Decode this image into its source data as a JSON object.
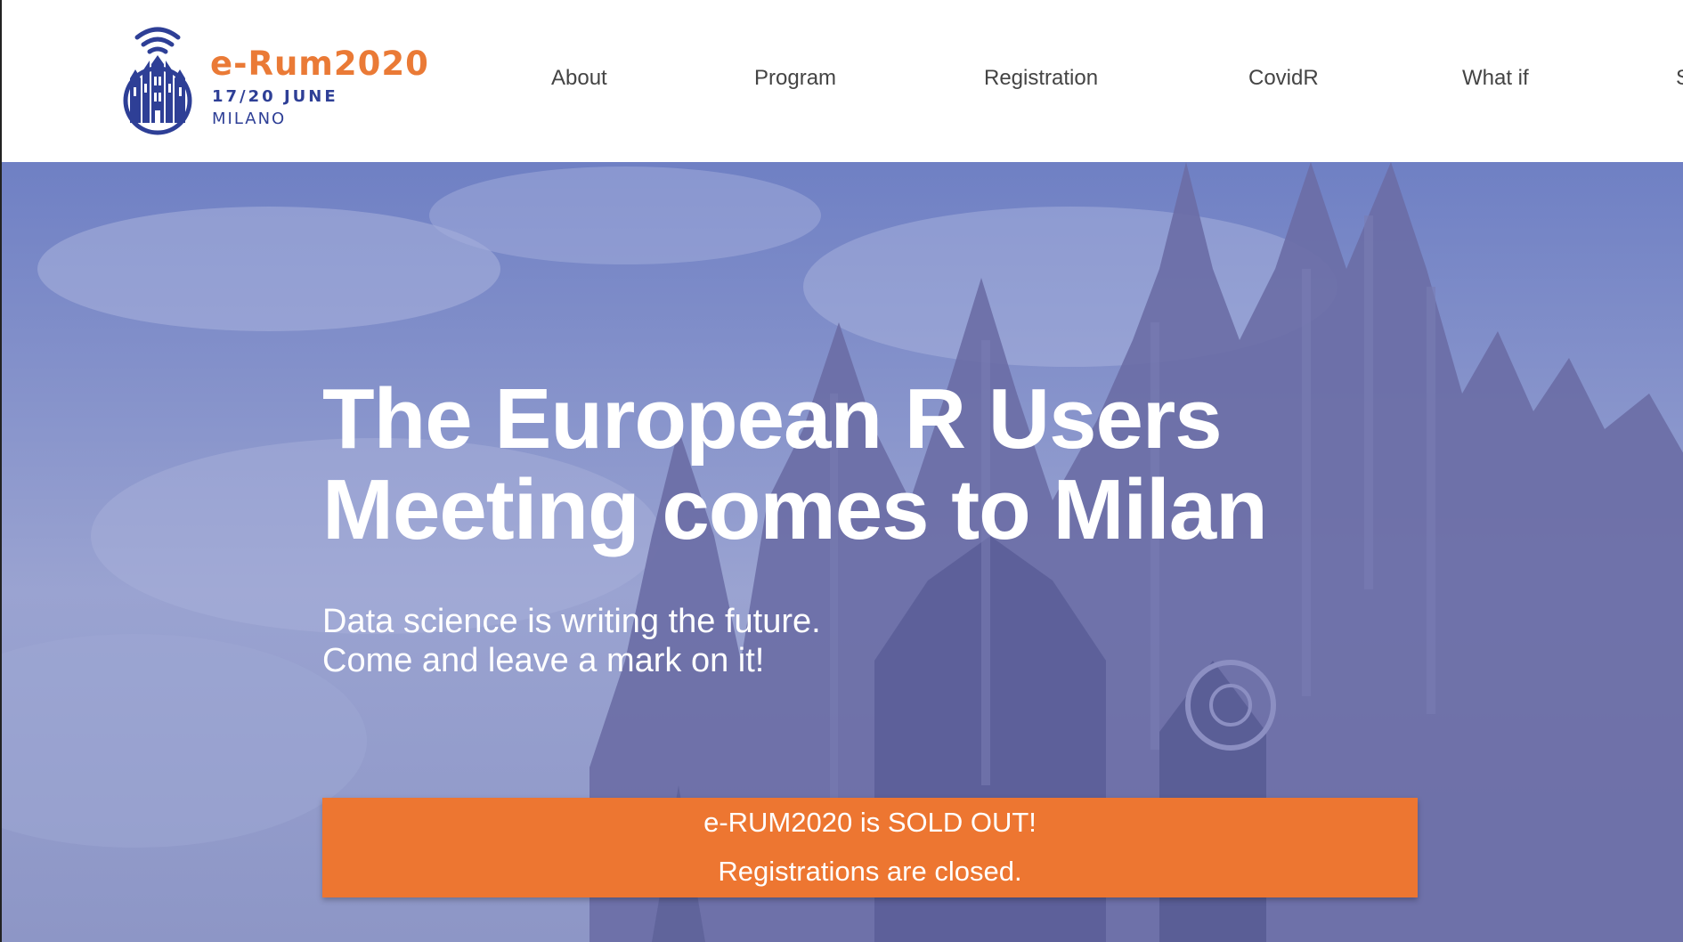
{
  "logo": {
    "title": "e-Rum2020",
    "dates": "17/20 JUNE",
    "city": "MILANO",
    "icon": "duomo-wifi-icon",
    "colors": {
      "orange": "#ea7a36",
      "blue": "#2e3f96"
    }
  },
  "nav": {
    "items": [
      {
        "label": "About"
      },
      {
        "label": "Program"
      },
      {
        "label": "Registration"
      },
      {
        "label": "CovidR"
      },
      {
        "label": "What if"
      },
      {
        "label": "S"
      }
    ]
  },
  "hero": {
    "title_line1": "The European R Users",
    "title_line2": "Meeting comes to Milan",
    "subtitle_line1": "Data science is writing the future.",
    "subtitle_line2": "Come and leave a mark on it!",
    "background": "milan-cathedral-photo",
    "overlay_color": "#6f80c4"
  },
  "banner": {
    "line1": "e-RUM2020 is SOLD OUT!",
    "line2": "Registrations are closed.",
    "color": "#ed7631"
  }
}
